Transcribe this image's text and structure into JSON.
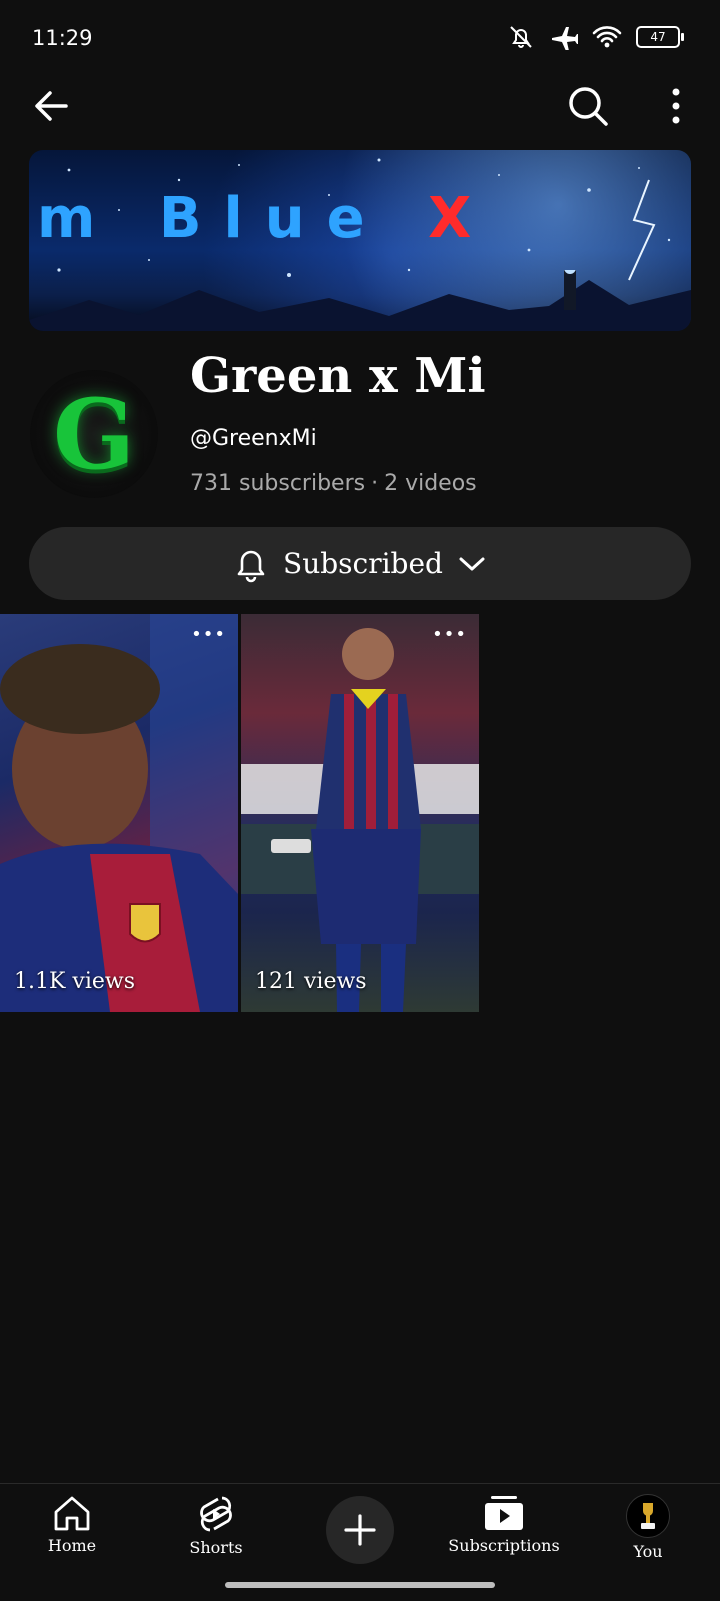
{
  "status_bar": {
    "time": "11:29",
    "battery": "47"
  },
  "banner": {
    "text_part1": "m Blue",
    "text_part2": "X"
  },
  "channel": {
    "name": "Green x Mi",
    "handle": "@GreenxMi",
    "subscribers": "731 subscribers",
    "videos": "2 videos",
    "avatar_letter": "G"
  },
  "subscribe_button": {
    "label": "Subscribed"
  },
  "shorts": [
    {
      "views": "1.1K views"
    },
    {
      "views": "121 views"
    }
  ],
  "nav": {
    "items": [
      {
        "label": "Home"
      },
      {
        "label": "Shorts"
      },
      {
        "label": "Subscriptions"
      },
      {
        "label": "You"
      }
    ]
  },
  "colors": {
    "background": "#0f0f0f",
    "button_bg": "#272727",
    "accent_green": "#18c43a"
  }
}
